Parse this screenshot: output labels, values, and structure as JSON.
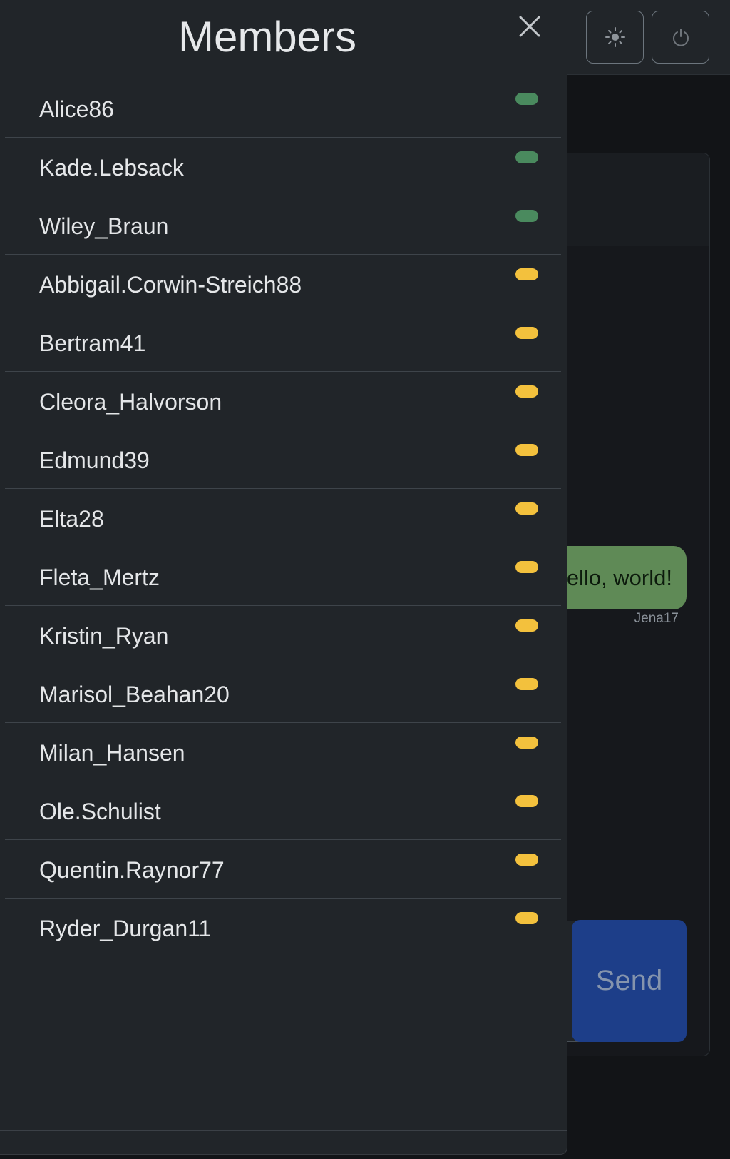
{
  "panel": {
    "title": "Members",
    "close_label": "×"
  },
  "status_colors": {
    "online": "#4a8a5e",
    "away": "#f3c13d"
  },
  "members": [
    {
      "name": "Alice86",
      "status": "online"
    },
    {
      "name": "Kade.Lebsack",
      "status": "online"
    },
    {
      "name": "Wiley_Braun",
      "status": "online"
    },
    {
      "name": "Abbigail.Corwin-Streich88",
      "status": "away"
    },
    {
      "name": "Bertram41",
      "status": "away"
    },
    {
      "name": "Cleora_Halvorson",
      "status": "away"
    },
    {
      "name": "Edmund39",
      "status": "away"
    },
    {
      "name": "Elta28",
      "status": "away"
    },
    {
      "name": "Fleta_Mertz",
      "status": "away"
    },
    {
      "name": "Kristin_Ryan",
      "status": "away"
    },
    {
      "name": "Marisol_Beahan20",
      "status": "away"
    },
    {
      "name": "Milan_Hansen",
      "status": "away"
    },
    {
      "name": "Ole.Schulist",
      "status": "away"
    },
    {
      "name": "Quentin.Raynor77",
      "status": "away"
    },
    {
      "name": "Ryder_Durgan11",
      "status": "away"
    }
  ],
  "chat": {
    "message_text": "ello, world!",
    "message_author": "Jena17",
    "send_label": "Send"
  },
  "toolbar": {
    "theme_icon": "sun-icon",
    "power_icon": "power-icon"
  }
}
